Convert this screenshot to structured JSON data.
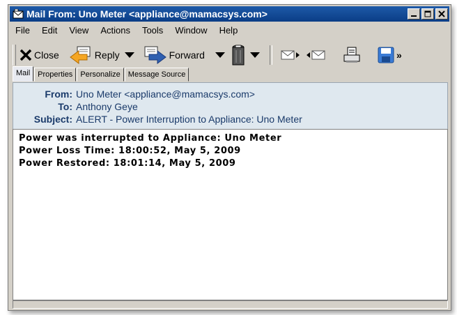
{
  "window": {
    "title": "Mail From: Uno Meter <appliance@mamacsys.com>"
  },
  "menubar": [
    "File",
    "Edit",
    "View",
    "Actions",
    "Tools",
    "Window",
    "Help"
  ],
  "toolbar": {
    "close_label": "Close",
    "reply_label": "Reply",
    "forward_label": "Forward",
    "more_label": "»"
  },
  "tabs": [
    "Mail",
    "Properties",
    "Personalize",
    "Message Source"
  ],
  "headers": {
    "from_label": "From:",
    "from_value": "Uno Meter <appliance@mamacsys.com>",
    "to_label": "To:",
    "to_value": "Anthony Geye",
    "subject_label": "Subject:",
    "subject_value": "ALERT - Power Interruption to Appliance: Uno Meter"
  },
  "body_lines": [
    "Power was interrupted to Appliance: Uno Meter",
    "Power Loss Time: 18:00:52, May 5, 2009",
    "Power Restored: 18:01:14, May 5, 2009"
  ],
  "colors": {
    "titlebar": "#0a3d86",
    "header_bg": "#dfe8ef",
    "header_text": "#1a3a6a"
  }
}
